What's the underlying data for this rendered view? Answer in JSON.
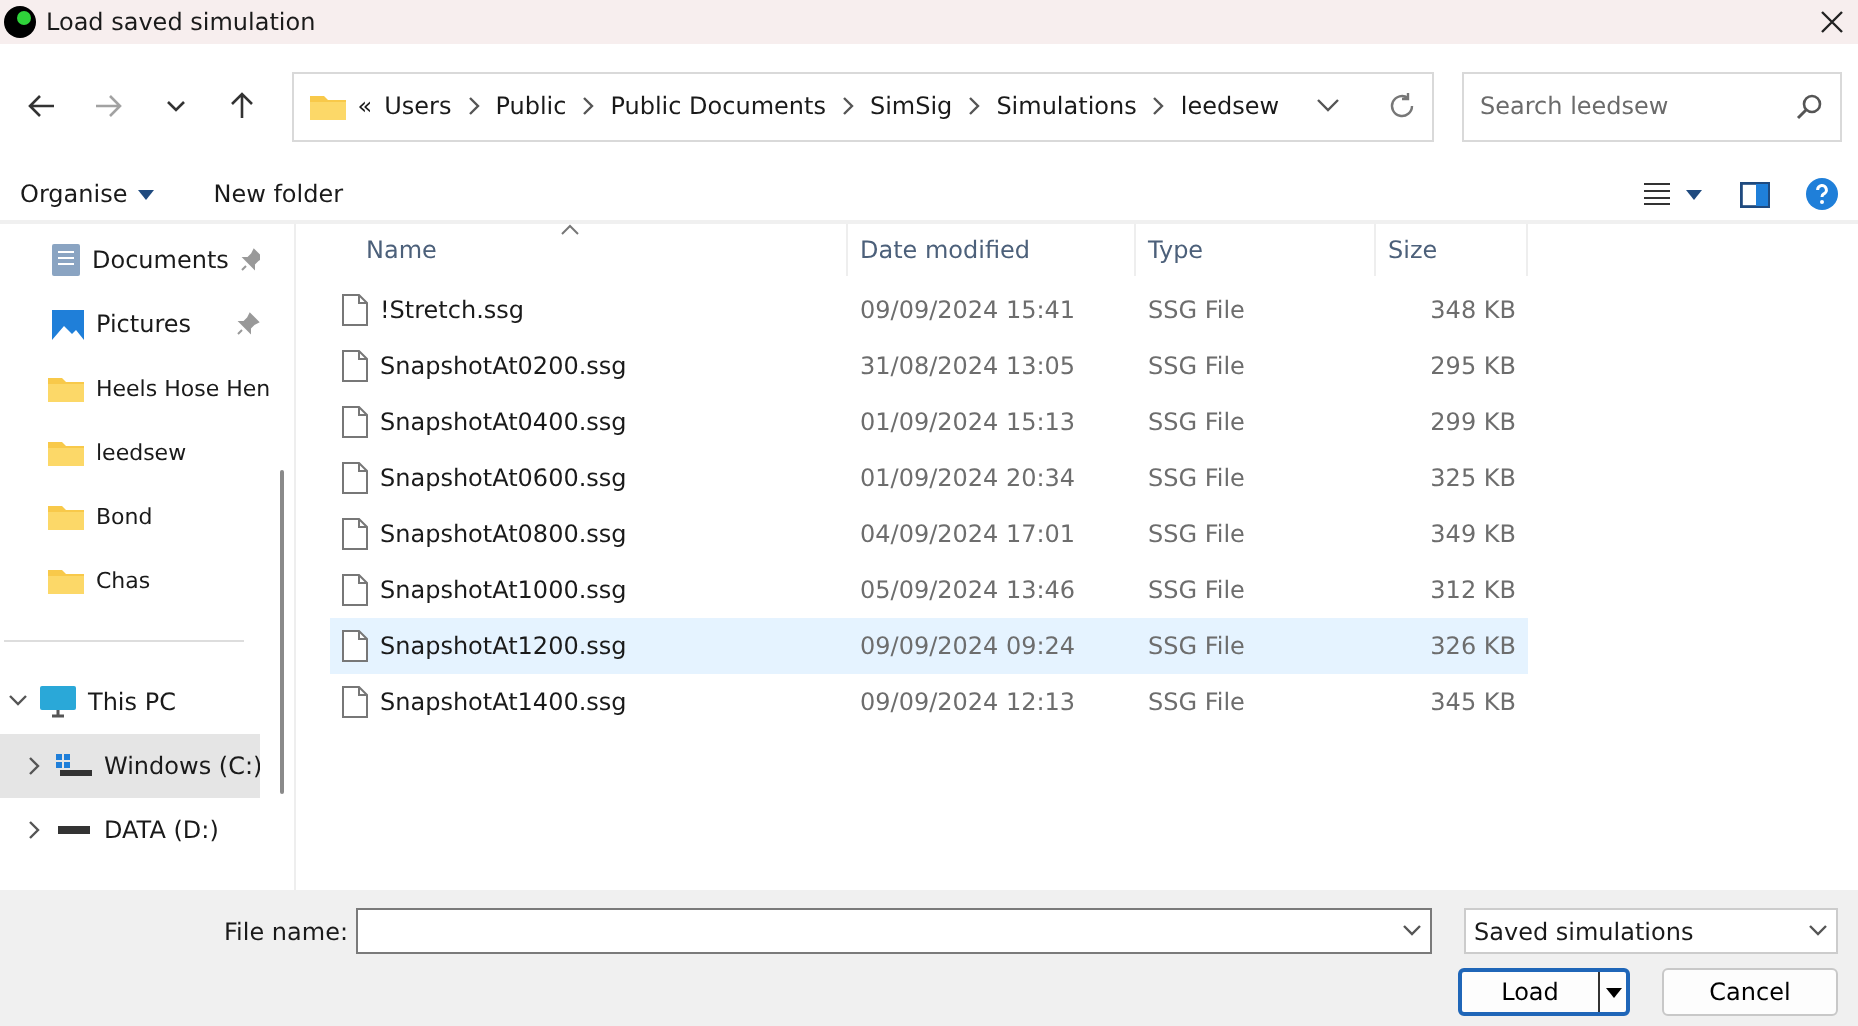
{
  "window": {
    "title": "Load saved simulation"
  },
  "address_bar": {
    "breadcrumbs": [
      "Users",
      "Public",
      "Public Documents",
      "SimSig",
      "Simulations",
      "leedsew"
    ],
    "overflow": "«"
  },
  "search": {
    "placeholder": "Search leedsew"
  },
  "command_bar": {
    "organise": "Organise",
    "new_folder": "New folder"
  },
  "sidebar": {
    "quick_access": [
      {
        "label": "Documents",
        "kind": "documents",
        "pinned": true
      },
      {
        "label": "Pictures",
        "kind": "pictures",
        "pinned": true
      },
      {
        "label": "Heels Hose Hen",
        "kind": "folder",
        "pinned": false
      },
      {
        "label": "leedsew",
        "kind": "folder",
        "pinned": false
      },
      {
        "label": "Bond",
        "kind": "folder",
        "pinned": false
      },
      {
        "label": "Chas",
        "kind": "folder",
        "pinned": false
      }
    ],
    "this_pc": {
      "label": "This PC",
      "expanded": true,
      "children": [
        {
          "label": "Windows (C:)",
          "kind": "windows-drive",
          "selected": true
        },
        {
          "label": "DATA (D:)",
          "kind": "drive",
          "selected": false
        }
      ]
    }
  },
  "table": {
    "columns": [
      "Name",
      "Date modified",
      "Type",
      "Size"
    ],
    "rows": [
      {
        "name": "!Stretch.ssg",
        "date": "09/09/2024 15:41",
        "type": "SSG File",
        "size": "348 KB",
        "selected": false
      },
      {
        "name": "SnapshotAt0200.ssg",
        "date": "31/08/2024 13:05",
        "type": "SSG File",
        "size": "295 KB",
        "selected": false
      },
      {
        "name": "SnapshotAt0400.ssg",
        "date": "01/09/2024 15:13",
        "type": "SSG File",
        "size": "299 KB",
        "selected": false
      },
      {
        "name": "SnapshotAt0600.ssg",
        "date": "01/09/2024 20:34",
        "type": "SSG File",
        "size": "325 KB",
        "selected": false
      },
      {
        "name": "SnapshotAt0800.ssg",
        "date": "04/09/2024 17:01",
        "type": "SSG File",
        "size": "349 KB",
        "selected": false
      },
      {
        "name": "SnapshotAt1000.ssg",
        "date": "05/09/2024 13:46",
        "type": "SSG File",
        "size": "312 KB",
        "selected": false
      },
      {
        "name": "SnapshotAt1200.ssg",
        "date": "09/09/2024 09:24",
        "type": "SSG File",
        "size": "326 KB",
        "selected": true
      },
      {
        "name": "SnapshotAt1400.ssg",
        "date": "09/09/2024 12:13",
        "type": "SSG File",
        "size": "345 KB",
        "selected": false
      }
    ]
  },
  "footer": {
    "file_name_label": "File name:",
    "file_type": "Saved simulations",
    "buttons": [
      "Load",
      "Cancel"
    ]
  }
}
